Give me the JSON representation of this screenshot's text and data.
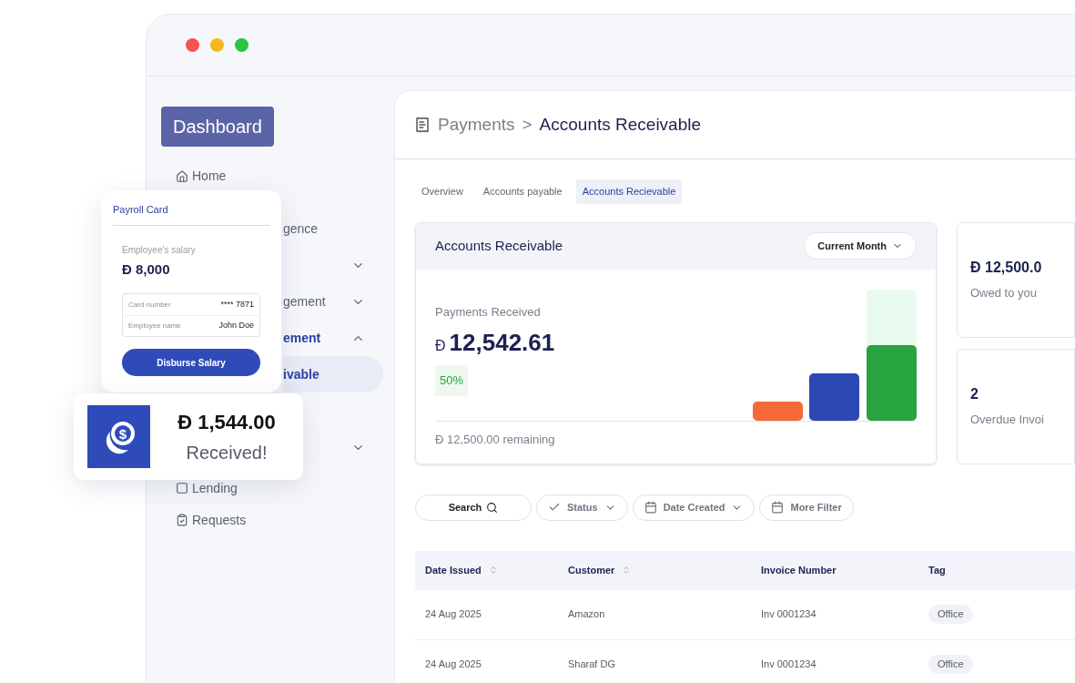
{
  "sidebar": {
    "logo": "Dashboard",
    "items": [
      {
        "label": "Home",
        "selected": false
      },
      {
        "label": "gence",
        "selected": false
      },
      {
        "selected": false,
        "expanded": false
      },
      {
        "label": "gement",
        "selected": false,
        "expanded": false
      },
      {
        "label": "ement",
        "selected": false,
        "expanded": true,
        "children": [
          {
            "label": "ivable",
            "selected": true
          }
        ]
      },
      {
        "selected": false
      },
      {
        "selected": false,
        "expanded": false
      },
      {
        "label": "Lending",
        "selected": false
      },
      {
        "label": "Requests",
        "selected": false
      }
    ]
  },
  "header": {
    "parent": "Payments",
    "separator": ">",
    "title": "Accounts Receivable"
  },
  "tabs": [
    {
      "label": "Overview",
      "selected": false
    },
    {
      "label": "Accounts payable",
      "selected": false
    },
    {
      "label": "Accounts Recievable",
      "selected": true
    }
  ],
  "summary_card": {
    "title": "Accounts Receivable",
    "period": "Current Month",
    "label": "Payments Received",
    "currency": "Đ",
    "amount": "12,542.61",
    "badge": "50%",
    "remaining": "Đ 12,500.00 remaining"
  },
  "stat_cards": [
    {
      "value": "Đ 12,500.0",
      "label": "Owed to you"
    },
    {
      "value": "2",
      "label": "Overdue Invoi"
    }
  ],
  "filters": [
    {
      "label": "Search",
      "kind": "search"
    },
    {
      "label": "Status",
      "kind": "status"
    },
    {
      "label": "Date Created",
      "kind": "date"
    },
    {
      "label": "More Filter",
      "kind": "more"
    }
  ],
  "table": {
    "columns": [
      {
        "label": "Date Issued",
        "sortable": true
      },
      {
        "label": "Customer",
        "sortable": true
      },
      {
        "label": "Invoice Number",
        "sortable": false
      },
      {
        "label": "Tag",
        "sortable": false
      }
    ],
    "rows": [
      [
        "24 Aug 2025",
        "Amazon",
        "Inv 0001234",
        "Office"
      ],
      [
        "24 Aug 2025",
        "Sharaf DG",
        "Inv 0001234",
        "Office"
      ]
    ]
  },
  "payroll_card": {
    "title": "Payroll Card",
    "salary_label": "Employee's salary",
    "salary": "Đ 8,000",
    "fields": [
      {
        "label": "Card number",
        "value": "**** 7871"
      },
      {
        "label": "Employee name",
        "value": "John Doe"
      }
    ],
    "button": "Disburse Salary"
  },
  "received_card": {
    "icon_glyph": "$",
    "amount": "Đ 1,544.00",
    "label": "Received!"
  }
}
